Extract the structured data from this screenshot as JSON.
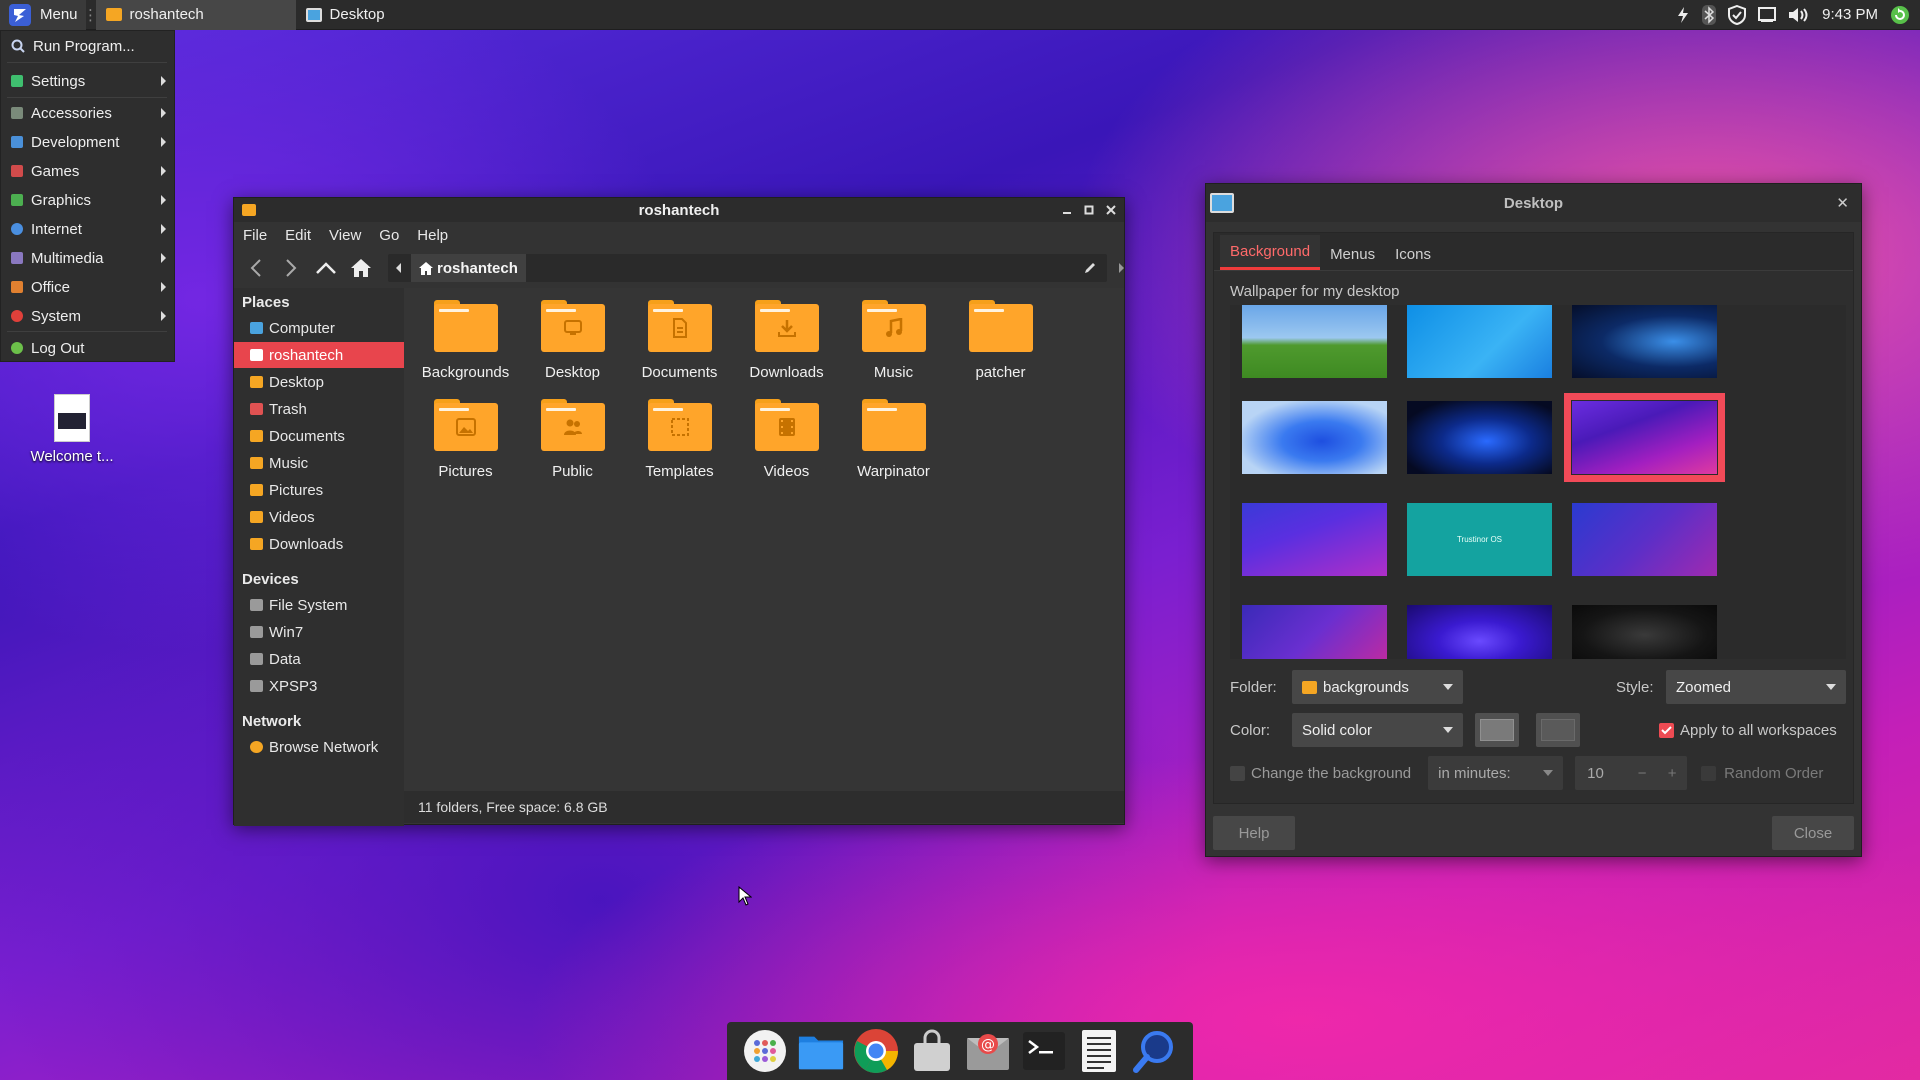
{
  "panel": {
    "menu_label": "Menu",
    "tasks": [
      {
        "label": "roshantech"
      },
      {
        "label": "Desktop"
      }
    ],
    "clock": "9:43 PM"
  },
  "app_menu": {
    "items": [
      {
        "label": "Run Program...",
        "color": "#9aa8c8",
        "submenu": false
      },
      {
        "label": "Settings",
        "color": "#3fbf6f",
        "submenu": true
      },
      {
        "label": "Accessories",
        "color": "#7a8a7a",
        "submenu": true
      },
      {
        "label": "Development",
        "color": "#4a90d9",
        "submenu": true
      },
      {
        "label": "Games",
        "color": "#d14b4b",
        "submenu": true
      },
      {
        "label": "Graphics",
        "color": "#4caf50",
        "submenu": true
      },
      {
        "label": "Internet",
        "color": "#4a8fe0",
        "submenu": true
      },
      {
        "label": "Multimedia",
        "color": "#8a78c0",
        "submenu": true
      },
      {
        "label": "Office",
        "color": "#e08030",
        "submenu": true
      },
      {
        "label": "System",
        "color": "#e0403a",
        "submenu": true
      },
      {
        "label": "Log Out",
        "color": "#6cc04a",
        "submenu": false
      }
    ]
  },
  "desktop_icon": {
    "label": "Welcome t..."
  },
  "file_manager": {
    "title": "roshantech",
    "menubar": [
      "File",
      "Edit",
      "View",
      "Go",
      "Help"
    ],
    "path": "roshantech",
    "sidebar": {
      "places_head": "Places",
      "places": [
        {
          "label": "Computer",
          "color": "#4aa3df"
        },
        {
          "label": "roshantech",
          "color": "#ffffff",
          "selected": true
        },
        {
          "label": "Desktop",
          "color": "#f5a623"
        },
        {
          "label": "Trash",
          "color": "#e05252"
        },
        {
          "label": "Documents",
          "color": "#f5a623"
        },
        {
          "label": "Music",
          "color": "#f5a623"
        },
        {
          "label": "Pictures",
          "color": "#f5a623"
        },
        {
          "label": "Videos",
          "color": "#f5a623"
        },
        {
          "label": "Downloads",
          "color": "#f5a623"
        }
      ],
      "devices_head": "Devices",
      "devices": [
        {
          "label": "File System",
          "color": "#9a9a9a"
        },
        {
          "label": "Win7",
          "color": "#9a9a9a"
        },
        {
          "label": "Data",
          "color": "#9a9a9a"
        },
        {
          "label": "XPSP3",
          "color": "#9a9a9a"
        }
      ],
      "network_head": "Network",
      "network": [
        {
          "label": "Browse Network",
          "color": "#f5a623"
        }
      ]
    },
    "folders": [
      {
        "label": "Backgrounds",
        "emblem": "none"
      },
      {
        "label": "Desktop",
        "emblem": "desktop"
      },
      {
        "label": "Documents",
        "emblem": "document"
      },
      {
        "label": "Downloads",
        "emblem": "download"
      },
      {
        "label": "Music",
        "emblem": "music"
      },
      {
        "label": "patcher",
        "emblem": "none"
      },
      {
        "label": "Pictures",
        "emblem": "picture"
      },
      {
        "label": "Public",
        "emblem": "people"
      },
      {
        "label": "Templates",
        "emblem": "template"
      },
      {
        "label": "Videos",
        "emblem": "video"
      },
      {
        "label": "Warpinator",
        "emblem": "none"
      }
    ],
    "status": "11 folders, Free space: 6.8 GB"
  },
  "desktop_dialog": {
    "title": "Desktop",
    "tabs": [
      "Background",
      "Menus",
      "Icons"
    ],
    "active_tab": "Background",
    "wallpaper_label": "Wallpaper for my desktop",
    "thumb_text_teal": "Trustinor OS",
    "folder_label": "Folder:",
    "folder_value": "backgrounds",
    "style_label": "Style:",
    "style_value": "Zoomed",
    "color_label": "Color:",
    "color_value": "Solid color",
    "apply_all": "Apply to all workspaces",
    "apply_all_checked": true,
    "change_bg": "Change the background",
    "change_bg_checked": false,
    "interval_unit": "in minutes:",
    "interval_value": "10",
    "random_order": "Random Order",
    "help_btn": "Help",
    "close_btn": "Close"
  },
  "dock": {
    "items": [
      "app-grid-icon",
      "files-icon",
      "chrome-icon",
      "store-icon",
      "mail-icon",
      "terminal-icon",
      "text-editor-icon",
      "search-icon"
    ]
  }
}
